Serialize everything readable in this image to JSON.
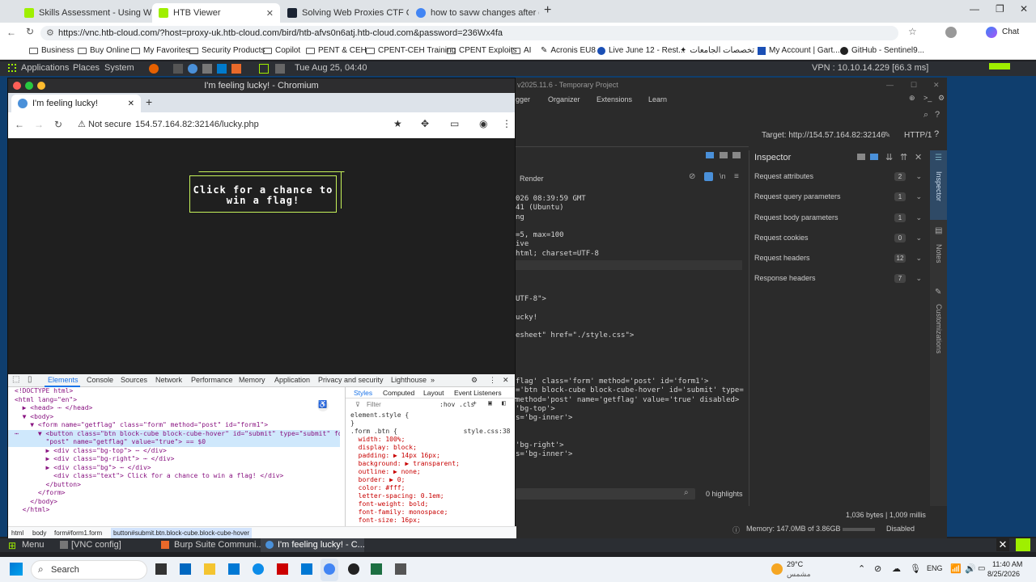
{
  "host_tabs": [
    {
      "title": "Skills Assessment - Using Web Pro",
      "color": "#9fef00",
      "active": false
    },
    {
      "title": "HTB Viewer",
      "color": "#9fef00",
      "active": true
    },
    {
      "title": "Solving Web Proxies CTF Challeng",
      "color": "#1a2332",
      "active": false
    },
    {
      "title": "how to savw changes after doing i",
      "color": "#4285f4",
      "active": false
    }
  ],
  "host_url": "https://vnc.htb-cloud.com/?host=proxy-uk.htb-cloud.com/bird/htb-afvs0n6atj.htb-cloud.com&password=236Wx4fa",
  "bookmarks": [
    "Business",
    "Buy Online",
    "My Favorites",
    "Security Products",
    "Copilot",
    "PENT & CEH",
    "CPENT-CEH Training",
    "CPENT Exploits",
    "AI",
    "Acronis EU8",
    "Live June 12 - Rest...",
    "تخصصات الجامعات",
    "My Account | Gart...",
    "GitHub - Sentinel9..."
  ],
  "gnome": {
    "applications": "Applications",
    "places": "Places",
    "system": "System",
    "datetime": "Tue Aug 25, 04:40",
    "vpn": "VPN : 10.10.14.229 [66.3 ms]"
  },
  "chromium": {
    "window_title": "I'm feeling lucky! - Chromium",
    "tab_title": "I'm feeling lucky!",
    "not_secure": "Not secure",
    "url": "154.57.164.82:32146/lucky.php",
    "button_text": "Click for a chance to win a flag!"
  },
  "devtools": {
    "tabs": [
      "Elements",
      "Console",
      "Sources",
      "Network",
      "Performance",
      "Memory",
      "Application",
      "Privacy and security",
      "Lighthouse"
    ],
    "dom": [
      "<!DOCTYPE html>",
      "<html lang=\"en\">",
      "  ▶ <head> ⋯ </head>",
      "  ▼ <body>",
      "    ▼ <form name=\"getflag\" class=\"form\" method=\"post\" id=\"form1\">",
      "⋯     ▼ <button class=\"btn block-cube block-cube-hover\" id=\"submit\" type=\"submit\" formmethod=",
      "        \"post\" name=\"getflag\" value=\"true\"> == $0",
      "        ▶ <div class=\"bg-top\"> ⋯ </div>",
      "        ▶ <div class=\"bg-right\"> ⋯ </div>",
      "        ▶ <div class=\"bg\"> ⋯ </div>",
      "          <div class=\"text\"> Click for a chance to win a flag! </div>",
      "        </button>",
      "      </form>",
      "    </body>",
      "  </html>"
    ],
    "styles_tabs": [
      "Styles",
      "Computed",
      "Layout",
      "Event Listeners"
    ],
    "filter": "Filter",
    "hov": ":hov .cls",
    "styles": [
      "element.style {",
      "}",
      ".form .btn {                 style.css:38",
      "  width: 100%;",
      "  display: block;",
      "  padding: ▶ 14px 16px;",
      "  background: ▶ transparent;",
      "  outline: ▶ none;",
      "  border: ▶ 0;",
      "  color: #fff;",
      "  letter-spacing: 0.1em;",
      "  font-weight: bold;",
      "  font-family: monospace;",
      "  font-size: 16px;"
    ],
    "crumbs": [
      "html",
      "body",
      "form#form1.form",
      "button#submit.btn.block-cube.block-cube-hover"
    ]
  },
  "burp": {
    "title": "v2025.11.6 - Temporary Project",
    "menu": [
      "gger",
      "Organizer",
      "Extensions",
      "Learn"
    ],
    "target": "Target: http://154.57.164.82:32146",
    "http": "HTTP/1",
    "render": "Render",
    "code": [
      "026 08:39:59 GMT",
      "41 (Ubuntu)",
      "ng",
      "",
      "=5, max=100",
      "ive",
      "html; charset=UTF-8",
      "",
      "",
      "",
      "",
      "UTF-8\">",
      "",
      "ucky!",
      "",
      "esheet\" href=\"./style.css\">",
      "",
      "",
      "",
      "",
      "flag' class='form' method='post' id='form1'>",
      "='btn block-cube block-cube-hover' id='submit' type=",
      "method='post' name='getflag' value='true' disabled>",
      "'bg-top'>",
      "s='bg-inner'>",
      "",
      "",
      "'bg-right'>",
      "s='bg-inner'>"
    ],
    "highlights": "0 highlights",
    "bytes": "1,036 bytes | 1,009 millis",
    "memory": "Memory: 147.0MB of 3.86GB",
    "disabled": "Disabled",
    "inspector_title": "Inspector",
    "inspector_rows": [
      {
        "label": "Request attributes",
        "count": "2"
      },
      {
        "label": "Request query parameters",
        "count": "1"
      },
      {
        "label": "Request body parameters",
        "count": "1"
      },
      {
        "label": "Request cookies",
        "count": "0"
      },
      {
        "label": "Request headers",
        "count": "12"
      },
      {
        "label": "Response headers",
        "count": "7"
      }
    ],
    "side": [
      "Inspector",
      "Notes",
      "Customizations"
    ]
  },
  "vnc_taskbar": {
    "menu": "Menu",
    "items": [
      "[VNC config]",
      "Burp Suite Communi...",
      "I'm feeling lucky! - C..."
    ]
  },
  "win_taskbar": {
    "search": "Search",
    "temp": "29°C",
    "weather": "مشمس",
    "lang": "ENG",
    "time": "11:40 AM",
    "date": "8/25/2026"
  }
}
